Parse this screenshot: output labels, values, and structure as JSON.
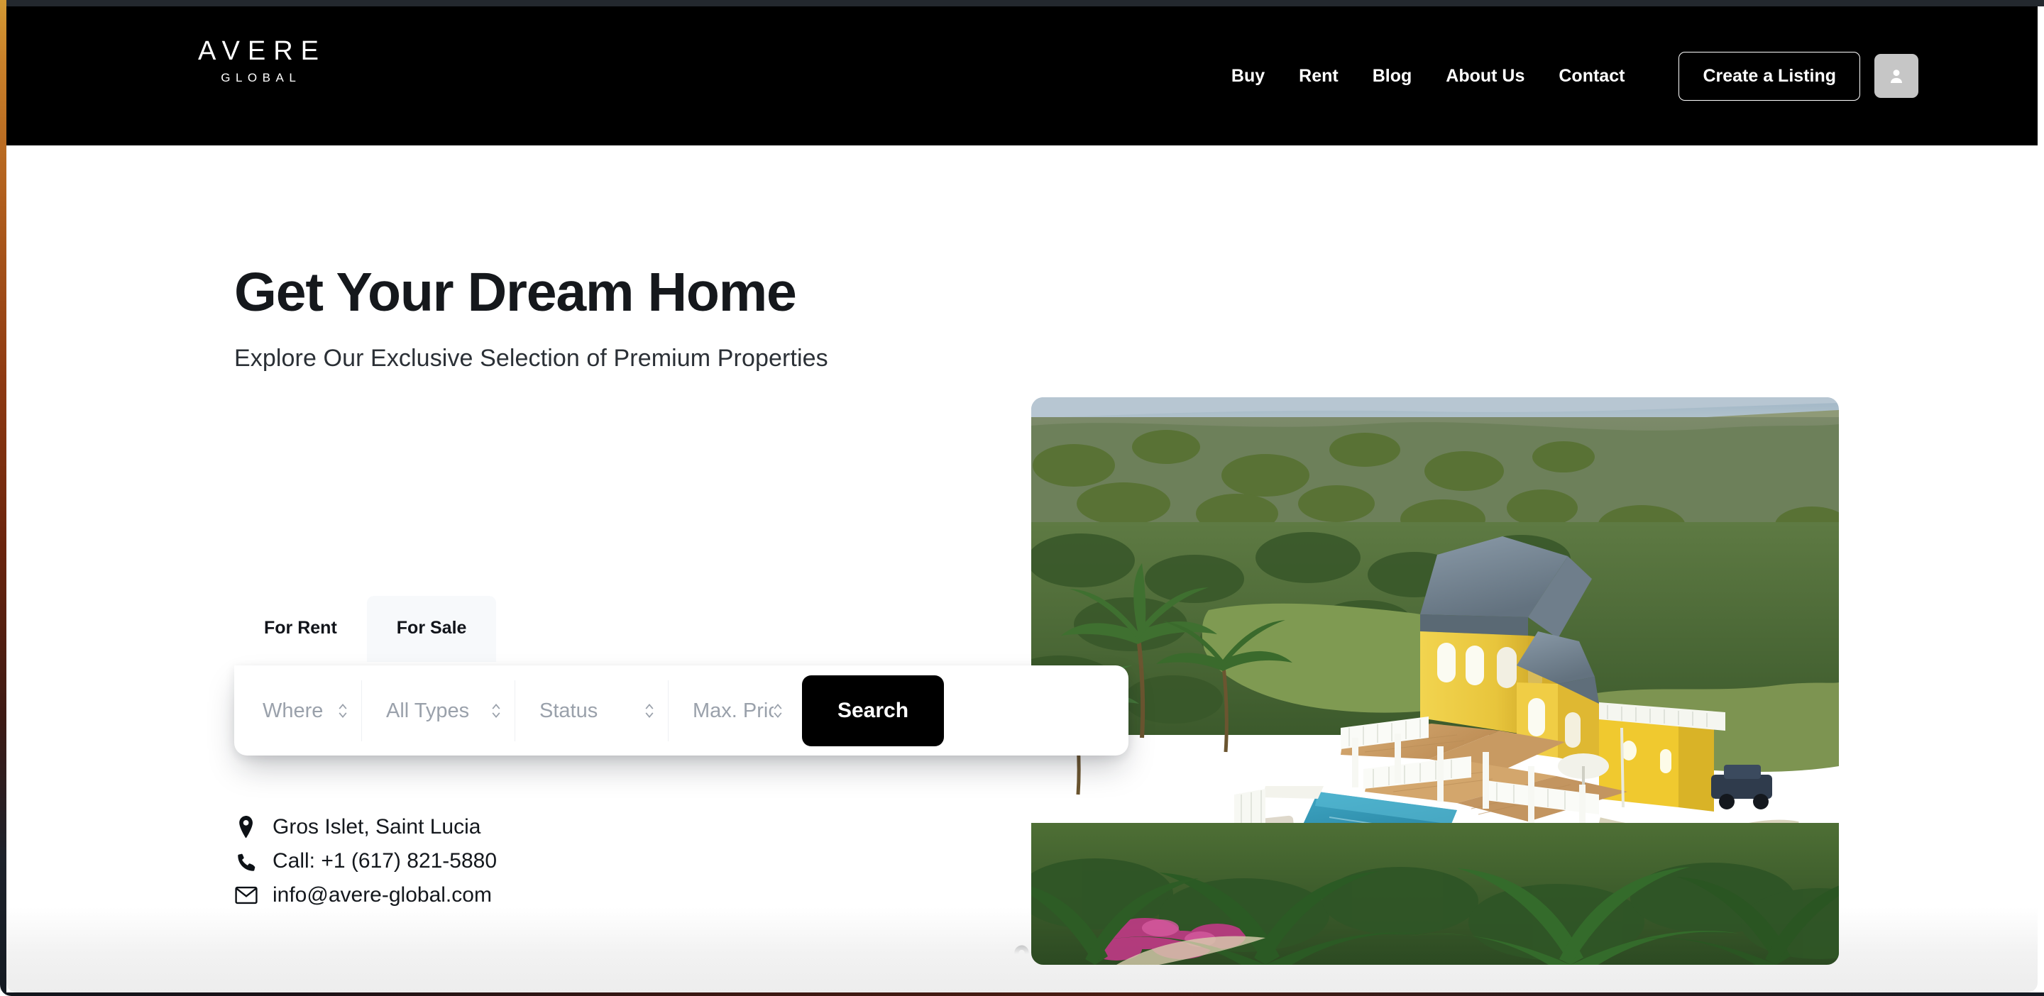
{
  "brand": {
    "logo_main": "AVERE",
    "logo_sub": "GLOBAL"
  },
  "header": {
    "nav": [
      {
        "label": "Buy"
      },
      {
        "label": "Rent"
      },
      {
        "label": "Blog"
      },
      {
        "label": "About Us"
      },
      {
        "label": "Contact"
      }
    ],
    "create_listing_label": "Create a Listing",
    "avatar_icon": "user-icon"
  },
  "hero": {
    "title": "Get Your Dream Home",
    "subtitle": "Explore Our Exclusive Selection of Premium Properties",
    "image_alt": "Aerial view of a yellow Caribbean villa with swimming pool surrounded by palm trees near the ocean"
  },
  "search": {
    "tabs": [
      {
        "label": "For Rent",
        "active": true
      },
      {
        "label": "For Sale",
        "active": false
      }
    ],
    "fields": [
      {
        "name": "location",
        "value": "Where",
        "options": [
          "Where"
        ]
      },
      {
        "name": "type",
        "value": "All Types",
        "options": [
          "All Types"
        ]
      },
      {
        "name": "status",
        "value": "Status",
        "options": [
          "Status"
        ]
      },
      {
        "name": "max_price",
        "value": "Max. Price",
        "options": [
          "Max. Price"
        ]
      }
    ],
    "submit_label": "Search"
  },
  "contact": {
    "items": [
      {
        "icon": "map-pin-icon",
        "text": "Gros Islet, Saint Lucia"
      },
      {
        "icon": "phone-icon",
        "text": "Call: +1 (617) 821-5880"
      },
      {
        "icon": "envelope-icon",
        "text": "info@avere-global.com"
      }
    ]
  },
  "divider": {
    "icon": "map-pin-icon"
  },
  "colors": {
    "header_bg": "#000000",
    "page_bg": "#ffffff",
    "accent_button": "#000000",
    "text_primary": "#14181d",
    "placeholder": "#9aa1ab",
    "tab_inactive_bg": "#f7f9fb",
    "avatar_bg": "#c6c6c6"
  }
}
